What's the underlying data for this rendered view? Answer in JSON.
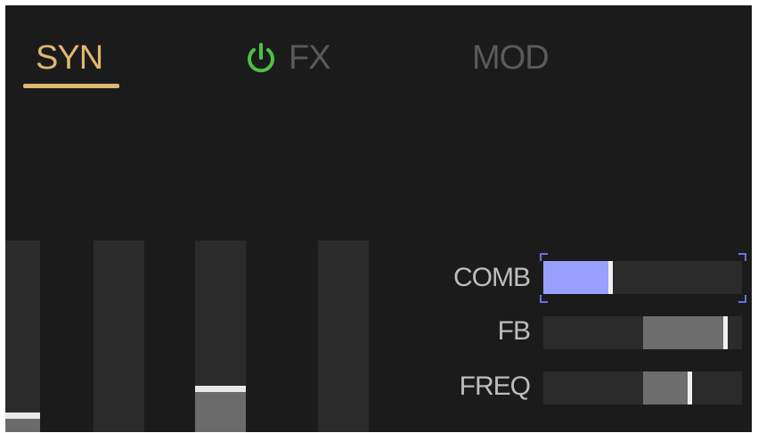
{
  "tabs": {
    "syn": "SYN",
    "fx": "FX",
    "mod": "MOD",
    "active": "SYN",
    "fx_power": "on"
  },
  "icons": {
    "fx_power": "power-icon"
  },
  "colors": {
    "active_tab": "#e0b770",
    "inactive_tab": "#5a5a5a",
    "power_on": "#4cc341",
    "comb_fill": "#9aa0ff",
    "background": "#1b1b1b"
  },
  "faders": [
    {
      "name": "fader-1",
      "value": 0.1
    },
    {
      "name": "fader-2",
      "value": 0.0
    },
    {
      "name": "fader-3",
      "value": 0.24
    },
    {
      "name": "fader-4",
      "value": 0.0
    }
  ],
  "sliders": [
    {
      "key": "comb",
      "label": "COMB",
      "value": 0.35,
      "fill_from": 0.0,
      "selected": true
    },
    {
      "key": "fb",
      "label": "FB",
      "value": 0.93,
      "fill_from": 0.5
    },
    {
      "key": "freq",
      "label": "FREQ",
      "value": 0.75,
      "fill_from": 0.5
    }
  ]
}
